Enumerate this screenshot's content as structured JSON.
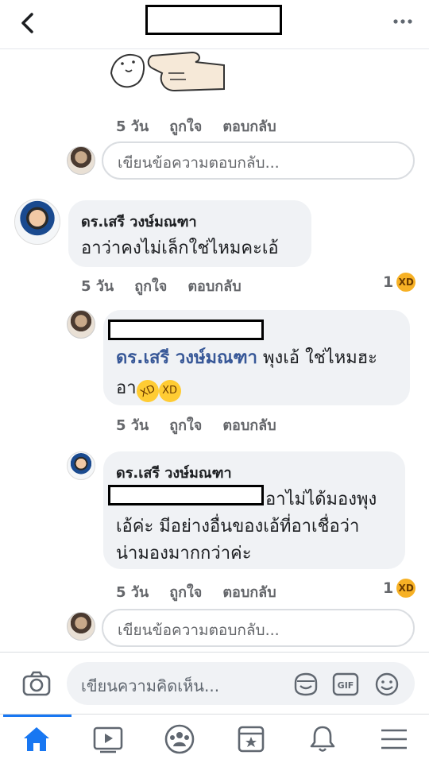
{
  "header": {
    "back_icon": "chevron-left-icon",
    "more_icon": "ellipsis-icon"
  },
  "sticker_comment": {
    "time": "5 วัน",
    "like": "ถูกใจ",
    "reply": "ตอบกลับ"
  },
  "reply_input_1": {
    "placeholder": "เขียนข้อความตอบกลับ..."
  },
  "comment_main": {
    "author": "ดร.เสรี วงษ์มณฑา",
    "text": "อาว่าคงไม่เล็กใช่ไหมคะเอ้",
    "time": "5 วัน",
    "like": "ถูกใจ",
    "reply": "ตอบกลับ",
    "reaction_count": "1"
  },
  "reply_1": {
    "mention": "ดร.เสรี วงษ์มณฑา",
    "text_line1": " พุงเอ้ ใช่ไหมฮะ",
    "text_line2": "อา",
    "time": "5 วัน",
    "like": "ถูกใจ",
    "reply": "ตอบกลับ"
  },
  "reply_2": {
    "author": "ดร.เสรี วงษ์มณฑา",
    "line1": "อาไม่ได้มองพุง",
    "line2": "เอ้ค่ะ มีอย่างอื่นของเอ้ที่อาเชื่อว่า",
    "line3": "น่ามองมากกว่าค่ะ",
    "time": "5 วัน",
    "like": "ถูกใจ",
    "reply": "ตอบกลับ",
    "reaction_count": "1"
  },
  "reply_input_2": {
    "placeholder": "เขียนข้อความตอบกลับ..."
  },
  "composer": {
    "placeholder": "เขียนความคิดเห็น...",
    "gif_label": "GIF"
  },
  "colors": {
    "accent": "#1877f2",
    "mention": "#385898",
    "bubble": "#f0f2f5"
  }
}
